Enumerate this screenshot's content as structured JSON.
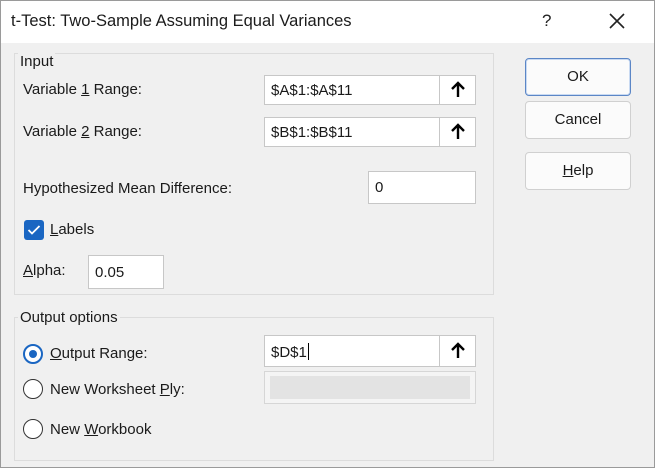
{
  "window": {
    "title": "t-Test: Two-Sample Assuming Equal Variances",
    "help_glyph": "?"
  },
  "input_group": {
    "label": "Input",
    "var1": {
      "pre": "Variable ",
      "accel": "1",
      "post": " Range:",
      "value": "$A$1:$A$11"
    },
    "var2": {
      "pre": "Variable ",
      "accel": "2",
      "post": " Range:",
      "value": "$B$1:$B$11"
    },
    "hypothesized": {
      "label": "Hypothesized Mean Difference:",
      "value": "0"
    },
    "labels": {
      "accel": "L",
      "post": "abels",
      "checked": true
    },
    "alpha": {
      "accel": "A",
      "post": "lpha:",
      "value": "0.05"
    }
  },
  "output_group": {
    "label": "Output options",
    "output_range": {
      "accel": "O",
      "post": "utput Range:",
      "value": "$D$1",
      "selected": true
    },
    "new_worksheet": {
      "pre": "New Worksheet ",
      "accel": "P",
      "post": "ly:",
      "selected": false
    },
    "new_workbook": {
      "pre": "New ",
      "accel": "W",
      "post": "orkbook",
      "selected": false
    }
  },
  "buttons": {
    "ok": "OK",
    "cancel": "Cancel",
    "help": {
      "accel": "H",
      "post": "elp"
    }
  },
  "colors": {
    "accent": "#1a66c2",
    "background": "#f0f0f0"
  }
}
